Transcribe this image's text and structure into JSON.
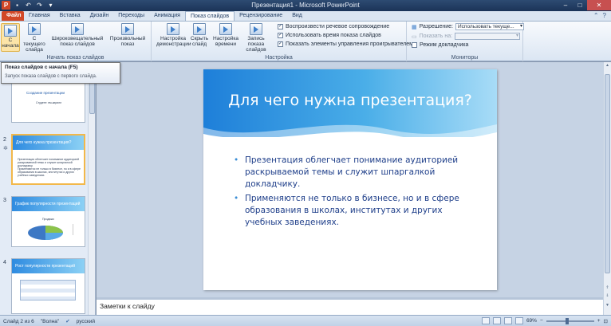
{
  "window": {
    "title": "Презентация1 - Microsoft PowerPoint",
    "app_icon": "P"
  },
  "tabs": [
    {
      "label": "Файл"
    },
    {
      "label": "Главная"
    },
    {
      "label": "Вставка"
    },
    {
      "label": "Дизайн"
    },
    {
      "label": "Переходы"
    },
    {
      "label": "Анимация"
    },
    {
      "label": "Показ слайдов"
    },
    {
      "label": "Рецензирование"
    },
    {
      "label": "Вид"
    }
  ],
  "ribbon": {
    "group_start": {
      "label": "Начать показ слайдов",
      "from_start": "С\nначала",
      "from_current": "С текущего\nслайда",
      "broadcast": "Широковещательный\nпоказ слайдов",
      "custom": "Произвольный\nпоказ"
    },
    "group_setup": {
      "label": "Настройка",
      "setup_show": "Настройка\nдемонстрации",
      "hide_slide": "Скрыть\nслайд",
      "rehearse": "Настройка\nвремени",
      "record": "Запись показа\nслайдов",
      "chk_narration": "Воспроизвести речевое сопровождение",
      "chk_timings": "Использовать время показа слайдов",
      "chk_controls": "Показать элементы управления проигрывателем"
    },
    "group_monitors": {
      "label": "Мониторы",
      "resolution_label": "Разрешение:",
      "resolution_value": "Использовать текуще...",
      "show_on_label": "Показать на:",
      "presenter_view": "Режим докладчика"
    }
  },
  "tooltip": {
    "title": "Показ слайдов с начала (F5)",
    "text": "Запуск показа слайдов с первого слайда."
  },
  "thumbnails": [
    {
      "num": "1",
      "title": "Создание презентации",
      "subtitle": "Студент: пм-кирилл"
    },
    {
      "num": "2",
      "title": "Для чего нужна презентация?",
      "lines": "Презентация облегчает понимание аудиторией раскрываемой темы и служит шпаргалкой докладчику.\nПрименяются не только в бизнесе, но и в сфере образования в школах, институтах и других учебных заведениях."
    },
    {
      "num": "3",
      "title": "График популярности презентаций",
      "chart_caption": "Продажи"
    },
    {
      "num": "4",
      "title": "Рост популярности презентаций"
    }
  ],
  "slide": {
    "title": "Для чего нужна презентация?",
    "bullets": [
      "Презентация облегчает понимание аудиторией раскрываемой темы и служит шпаргалкой докладчику.",
      "Применяются не только в бизнесе, но и в сфере образования в школах, институтах и других учебных заведениях."
    ]
  },
  "notes": {
    "placeholder": "Заметки к слайду"
  },
  "status": {
    "slide_info": "Слайд 2 из 6",
    "theme": "\"Волна\"",
    "language": "русский",
    "zoom": "69%"
  }
}
